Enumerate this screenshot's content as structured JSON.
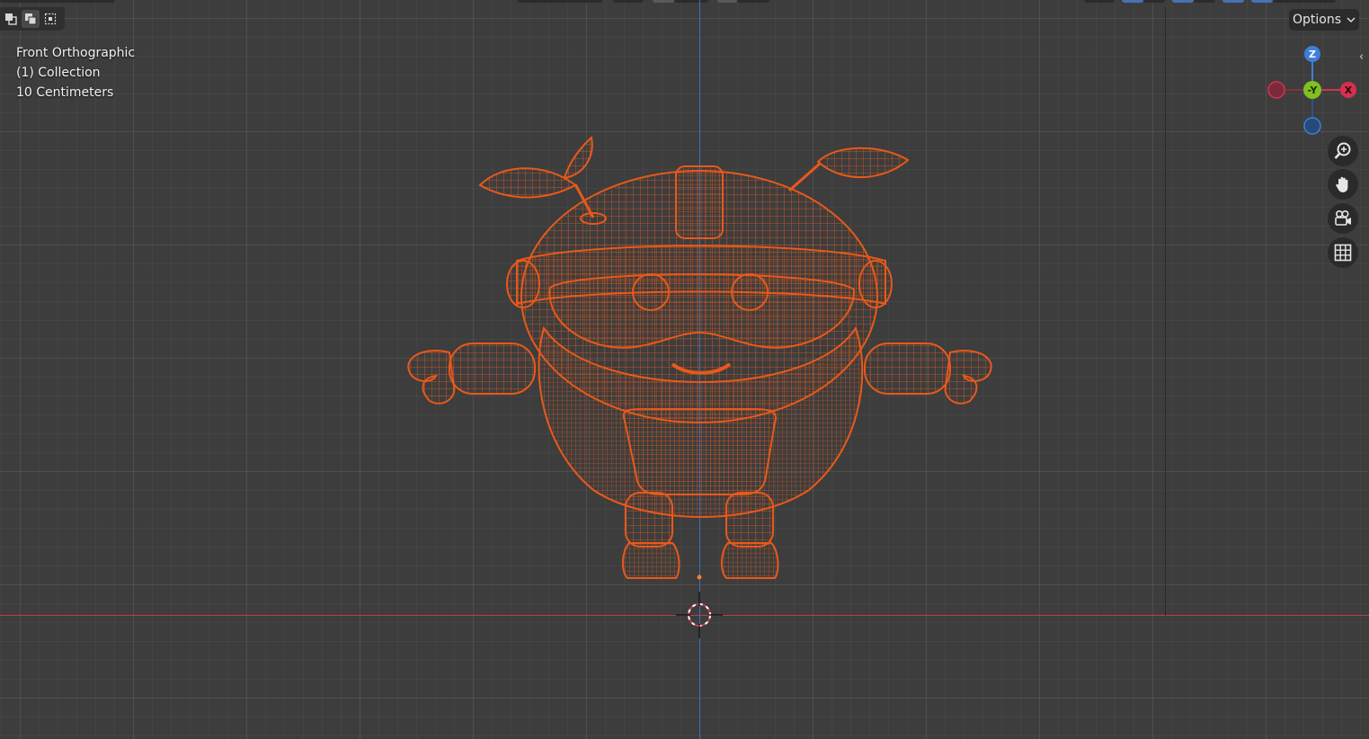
{
  "viewport": {
    "view_name": "Front Orthographic",
    "collection": "(1) Collection",
    "scale": "10 Centimeters"
  },
  "header": {
    "options_label": "Options"
  },
  "gizmo": {
    "z_label": "Z",
    "y_label": "-Y",
    "x_label": "X"
  },
  "colors": {
    "background": "#3d3d3d",
    "wireframe": "#e8591a",
    "axis_x": "#d6304f",
    "axis_y": "#80c020",
    "axis_z": "#3d7fd9"
  },
  "icons": {
    "select_modes": [
      "select-new-icon",
      "select-extend-icon",
      "select-subtract-icon"
    ],
    "navigation": [
      "zoom-icon",
      "hand-pan-icon",
      "camera-view-icon",
      "grid-ortho-icon"
    ]
  }
}
